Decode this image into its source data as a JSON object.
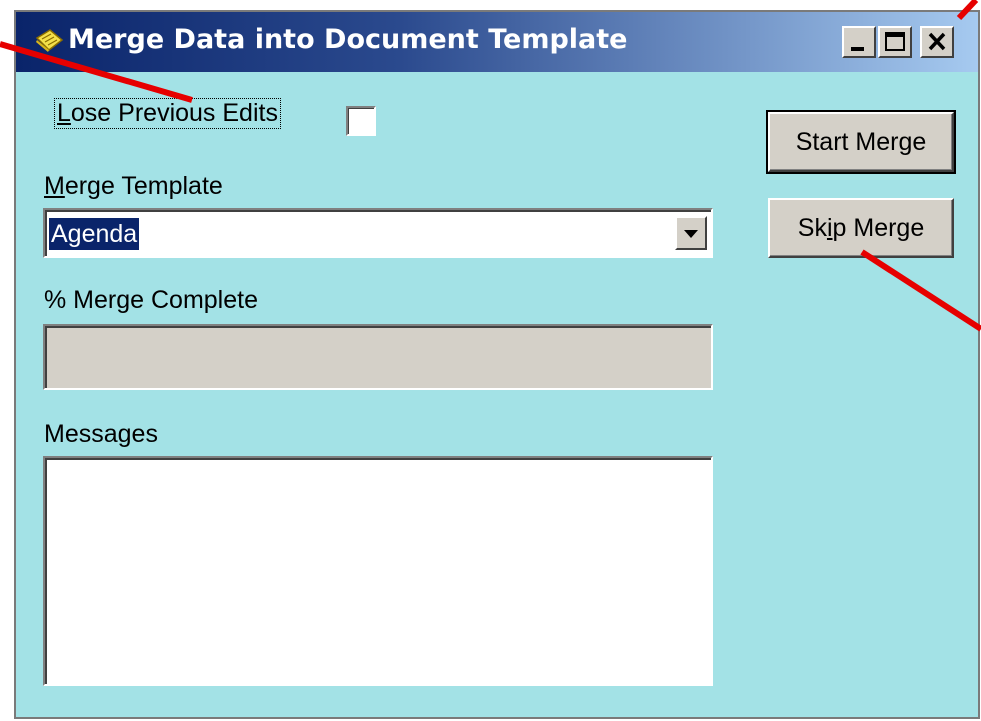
{
  "window": {
    "title": "Merge Data into Document Template",
    "icon": "document-merge-icon",
    "caption_buttons": {
      "minimize": "minimize-icon",
      "maximize": "maximize-icon",
      "close": "close-icon"
    }
  },
  "form": {
    "lose_edits": {
      "label_underlined": "L",
      "label_rest": "ose Previous Edits",
      "checked": false
    },
    "template": {
      "label_underlined": "M",
      "label_rest": "erge Template",
      "selected_value": "Agenda"
    },
    "progress": {
      "label": "% Merge Complete",
      "percent": 0
    },
    "messages": {
      "label": "Messages",
      "content": ""
    }
  },
  "buttons": {
    "start_merge": "Start Merge",
    "skip_merge_prefix": "Sk",
    "skip_merge_underlined": "i",
    "skip_merge_suffix": "p Merge"
  },
  "colors": {
    "window_background": "#a3e2e6",
    "titlebar_start": "#0a246a",
    "titlebar_end": "#a6caf0",
    "selection": "#0a246a",
    "annotation_line": "#e60000"
  }
}
